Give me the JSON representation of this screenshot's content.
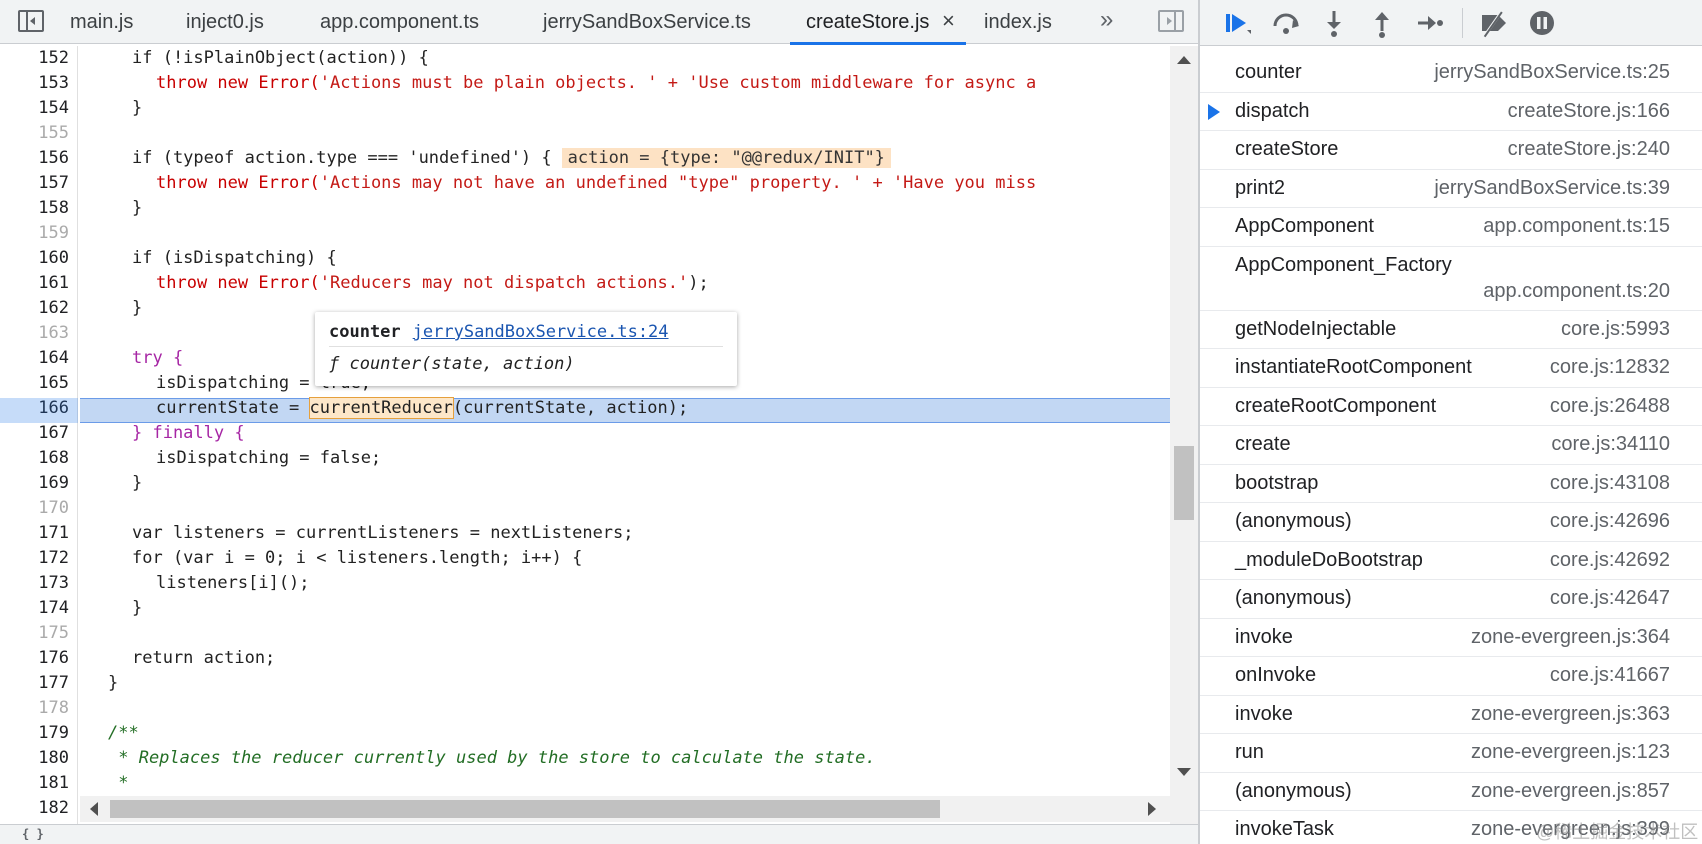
{
  "tabs": [
    {
      "label": "main.js",
      "active": false
    },
    {
      "label": "inject0.js",
      "active": false
    },
    {
      "label": "app.component.ts",
      "active": false
    },
    {
      "label": "jerrySandBoxService.ts",
      "active": false
    },
    {
      "label": "createStore.js",
      "active": true
    },
    {
      "label": "index.js",
      "active": false
    }
  ],
  "icons": {
    "tab_close": "×",
    "tab_more": "»",
    "navigator_toggle": "sidebar-toggle-icon",
    "debugger_toggle": "debugger-sidebar-toggle-icon"
  },
  "editor": {
    "current_line": "166",
    "line_numbers": [
      "152",
      "153",
      "154",
      "155",
      "156",
      "157",
      "158",
      "159",
      "160",
      "161",
      "162",
      "163",
      "164",
      "165",
      "166",
      "167",
      "168",
      "169",
      "170",
      "171",
      "172",
      "173",
      "174",
      "175",
      "176",
      "177",
      "178",
      "179",
      "180",
      "181",
      "182"
    ],
    "inline_value": "action = {type: \"@@redux/INIT\"}",
    "lines": {
      "l152": "if (!isPlainObject(action)) {",
      "l153a": "throw new Error(",
      "l153b": "'Actions must be plain objects. ' + 'Use custom middleware for async a",
      "l154": "}",
      "l156": "if (typeof action.type === 'undefined') {",
      "l157a": "throw new Error(",
      "l157b": "'Actions may not have an undefined \"type\" property. ' + 'Have you miss",
      "l158": "}",
      "l160": "if (isDispatching) {",
      "l161a": "throw new Error(",
      "l161b": "'Reducers may not dispatch actions.'",
      "l161c": ");",
      "l162": "}",
      "l164": "try {",
      "l165": "isDispatching = true;",
      "l166a": "currentState = ",
      "l166b": "currentReducer",
      "l166c": "(currentState, action);",
      "l167": "} finally {",
      "l168": "isDispatching = false;",
      "l169": "}",
      "l171": "var listeners = currentListeners = nextListeners;",
      "l172": "for (var i = 0; i < listeners.length; i++) {",
      "l173": "listeners[i]();",
      "l174": "}",
      "l176": "return action;",
      "l177": "}",
      "l179": "/**",
      "l180": " * Replaces the reducer currently used by the store to calculate the state.",
      "l181": " *"
    }
  },
  "tooltip": {
    "name": "counter",
    "location": "jerrySandBoxService.ts:24",
    "signature": "ƒ counter(state, action)"
  },
  "debugger_toolbar": [
    {
      "name": "resume-icon",
      "label": "Resume script execution"
    },
    {
      "name": "step-over-icon",
      "label": "Step over next function call"
    },
    {
      "name": "step-into-icon",
      "label": "Step into next function call"
    },
    {
      "name": "step-out-icon",
      "label": "Step out of current function"
    },
    {
      "name": "step-icon",
      "label": "Step"
    },
    {
      "name": "deactivate-breakpoints-icon",
      "label": "Deactivate breakpoints"
    },
    {
      "name": "pause-on-exceptions-icon",
      "label": "Pause on exceptions"
    }
  ],
  "call_stack": [
    {
      "name": "counter",
      "location": "jerrySandBoxService.ts:25",
      "current": false
    },
    {
      "name": "dispatch",
      "location": "createStore.js:166",
      "current": true
    },
    {
      "name": "createStore",
      "location": "createStore.js:240",
      "current": false
    },
    {
      "name": "print2",
      "location": "jerrySandBoxService.ts:39",
      "current": false
    },
    {
      "name": "AppComponent",
      "location": "app.component.ts:15",
      "current": false
    },
    {
      "name": "AppComponent_Factory",
      "location": "app.component.ts:20",
      "current": false
    },
    {
      "name": "getNodeInjectable",
      "location": "core.js:5993",
      "current": false
    },
    {
      "name": "instantiateRootComponent",
      "location": "core.js:12832",
      "current": false
    },
    {
      "name": "createRootComponent",
      "location": "core.js:26488",
      "current": false
    },
    {
      "name": "create",
      "location": "core.js:34110",
      "current": false
    },
    {
      "name": "bootstrap",
      "location": "core.js:43108",
      "current": false
    },
    {
      "name": "(anonymous)",
      "location": "core.js:42696",
      "current": false
    },
    {
      "name": "_moduleDoBootstrap",
      "location": "core.js:42692",
      "current": false
    },
    {
      "name": "(anonymous)",
      "location": "core.js:42647",
      "current": false
    },
    {
      "name": "invoke",
      "location": "zone-evergreen.js:364",
      "current": false
    },
    {
      "name": "onInvoke",
      "location": "core.js:41667",
      "current": false
    },
    {
      "name": "invoke",
      "location": "zone-evergreen.js:363",
      "current": false
    },
    {
      "name": "run",
      "location": "zone-evergreen.js:123",
      "current": false
    },
    {
      "name": "(anonymous)",
      "location": "zone-evergreen.js:857",
      "current": false
    },
    {
      "name": "invokeTask",
      "location": "zone-evergreen.js:399",
      "current": false
    }
  ],
  "status_bar": {
    "brace": "{ }"
  },
  "watermark": "@稀土掘金技术社区",
  "colors": {
    "accent": "#1a73e8",
    "exec_line": "#c2d7f3",
    "inline_value_bg": "#fde2c4"
  }
}
